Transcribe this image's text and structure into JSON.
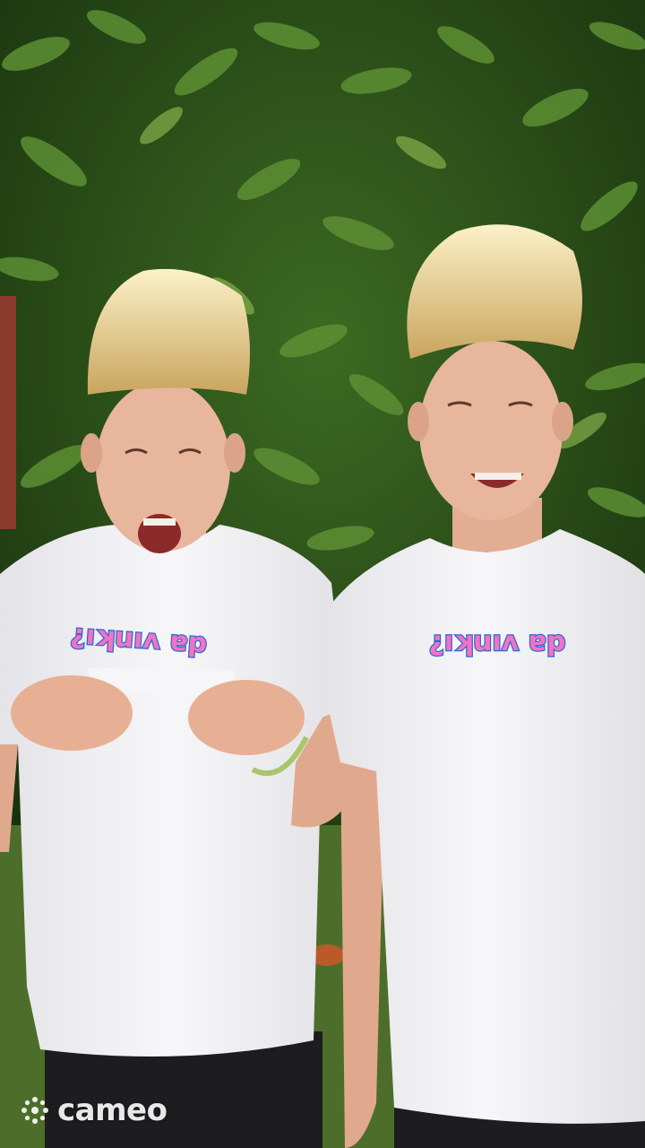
{
  "scene": {
    "description_free": true,
    "colors": {
      "foliage_dark": "#1f3b14",
      "foliage_light": "#5e8f34",
      "grass": "#4d6e2a",
      "shirt": "#f2f2f4",
      "hair": "#f1e0a6",
      "skin": "#e8b69c",
      "shorts": "#1d1d1f",
      "shirt_text_fill": "#f272c4",
      "shirt_text_outline": "#2c6bd0"
    }
  },
  "shirt_left": {
    "text": "¿ıʞuıʌ ɐp"
  },
  "shirt_right": {
    "text": "¿ıʞuıʌ ɐp"
  },
  "watermark": {
    "label": "cameo",
    "icon": "cameo-logo-icon"
  }
}
